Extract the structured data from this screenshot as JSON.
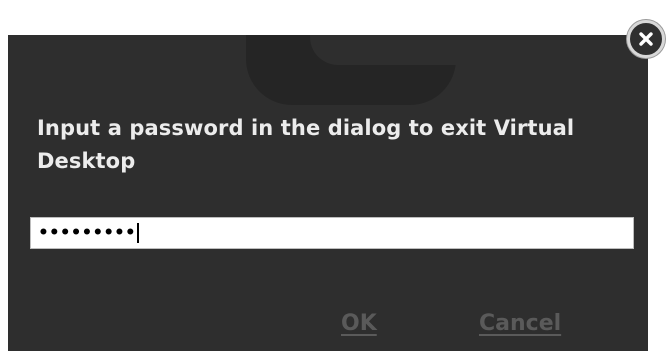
{
  "dialog": {
    "message": "Input a password in the dialog to exit Virtual Desktop",
    "password": {
      "masked_value": "•••••••••"
    },
    "buttons": {
      "ok_label": "OK",
      "cancel_label": "Cancel"
    },
    "close_icon": "close-icon"
  },
  "colors": {
    "dialog_background": "#2e2e2e",
    "message_text": "#ececec",
    "button_text": "#5a5a5a",
    "field_background": "#ffffff"
  }
}
